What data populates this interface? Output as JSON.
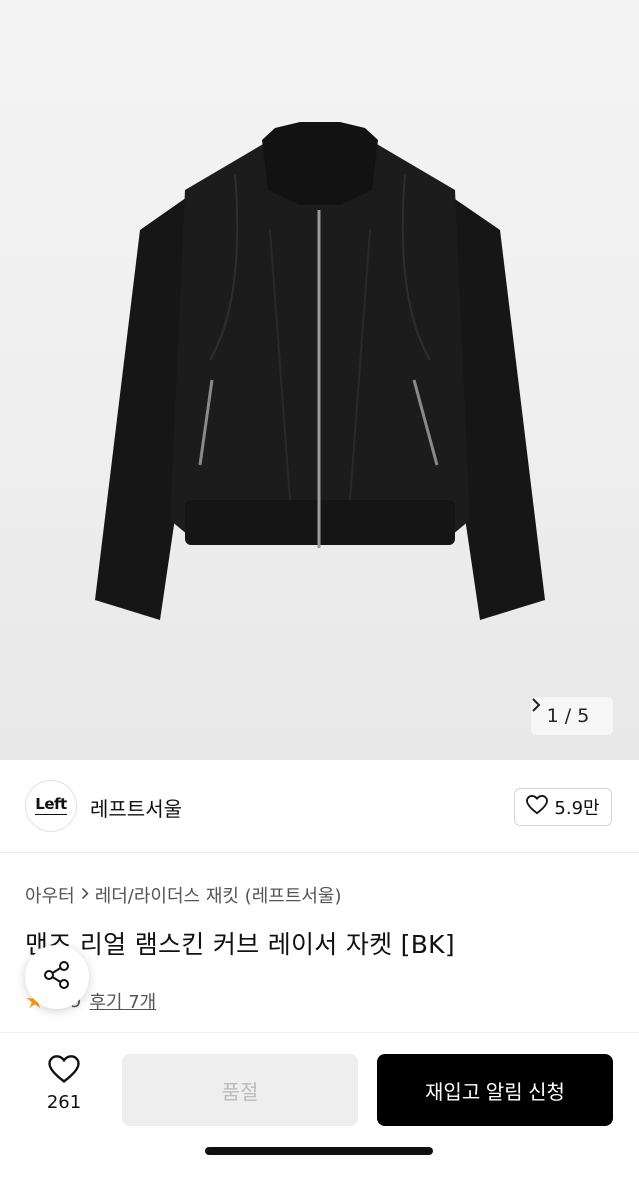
{
  "gallery": {
    "image_alt": "black leather jacket",
    "counter_current": "1",
    "counter_separator": "/",
    "counter_total": "5",
    "next_icon": "chevron-right-icon"
  },
  "brand": {
    "logo_text": "Left",
    "name": "레프트서울",
    "likes": "5.9만",
    "like_icon": "heart-outline-icon"
  },
  "breadcrumb": {
    "category": "아우터",
    "subcategory": "레더/라이더스 재킷 (레프트서울)"
  },
  "product": {
    "title": "맨즈 리얼 램스킨 커브 레이서 자켓 [BK]",
    "rating": "4.9",
    "reviews": "후기 7개"
  },
  "bottom_bar": {
    "wish_count": "261",
    "soldout_label": "품절",
    "restock_label": "재입고 알림 신청"
  },
  "colors": {
    "accent": "#000000",
    "star": "#f5a623",
    "disabled_bg": "#eeeeee"
  }
}
